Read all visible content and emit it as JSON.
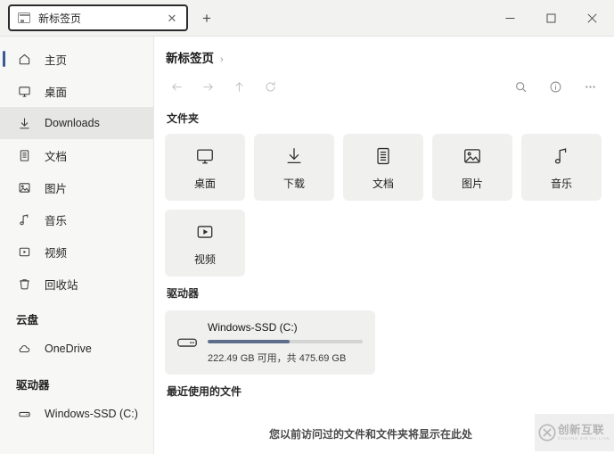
{
  "window": {
    "tab": {
      "title": "新标签页",
      "icon": "browser-tab-icon",
      "close_label": "✕"
    },
    "new_tab_label": "+",
    "controls": {
      "minimize": "minimize-icon",
      "maximize": "maximize-icon",
      "close": "close-icon"
    }
  },
  "sidebar": {
    "items": [
      {
        "label": "主页",
        "icon": "home-icon",
        "selected": false,
        "indicator": true
      },
      {
        "label": "桌面",
        "icon": "monitor-icon",
        "selected": false,
        "indicator": false
      },
      {
        "label": "Downloads",
        "icon": "download-icon",
        "selected": true,
        "indicator": false
      },
      {
        "label": "文档",
        "icon": "document-icon",
        "selected": false,
        "indicator": false
      },
      {
        "label": "图片",
        "icon": "image-icon",
        "selected": false,
        "indicator": false
      },
      {
        "label": "音乐",
        "icon": "music-icon",
        "selected": false,
        "indicator": false
      },
      {
        "label": "视频",
        "icon": "video-icon",
        "selected": false,
        "indicator": false
      },
      {
        "label": "回收站",
        "icon": "trash-icon",
        "selected": false,
        "indicator": false
      }
    ],
    "groups": [
      {
        "title": "云盘",
        "items": [
          {
            "label": "OneDrive",
            "icon": "cloud-icon"
          }
        ]
      },
      {
        "title": "驱动器",
        "items": [
          {
            "label": "Windows-SSD (C:)",
            "icon": "drive-icon"
          }
        ]
      }
    ]
  },
  "content": {
    "breadcrumb": {
      "current": "新标签页",
      "separator": "›"
    },
    "toolbar": {
      "back": "back-arrow-icon",
      "forward": "forward-arrow-icon",
      "up": "up-arrow-icon",
      "refresh": "refresh-icon",
      "search": "search-icon",
      "info": "info-icon",
      "more": "more-icon"
    },
    "folders_section": {
      "title": "文件夹",
      "tiles": [
        {
          "label": "桌面",
          "icon": "monitor-icon"
        },
        {
          "label": "下载",
          "icon": "download-icon"
        },
        {
          "label": "文档",
          "icon": "document-icon"
        },
        {
          "label": "图片",
          "icon": "image-icon"
        },
        {
          "label": "音乐",
          "icon": "music-icon"
        },
        {
          "label": "视频",
          "icon": "video-icon"
        }
      ]
    },
    "drives_section": {
      "title": "驱动器",
      "drives": [
        {
          "name": "Windows-SSD (C:)",
          "detail": "222.49 GB 可用，共 475.69 GB",
          "used_percent": 53,
          "fill_color": "#5d6e8c",
          "track_color": "#d4d4d2"
        }
      ]
    },
    "recent_section": {
      "title": "最近使用的文件",
      "empty_message": "您以前访问过的文件和文件夹将显示在此处"
    }
  },
  "watermark": {
    "main": "创新互联",
    "sub": "CHUANG XIN HU LIAN",
    "logo": "circled-x-logo"
  }
}
